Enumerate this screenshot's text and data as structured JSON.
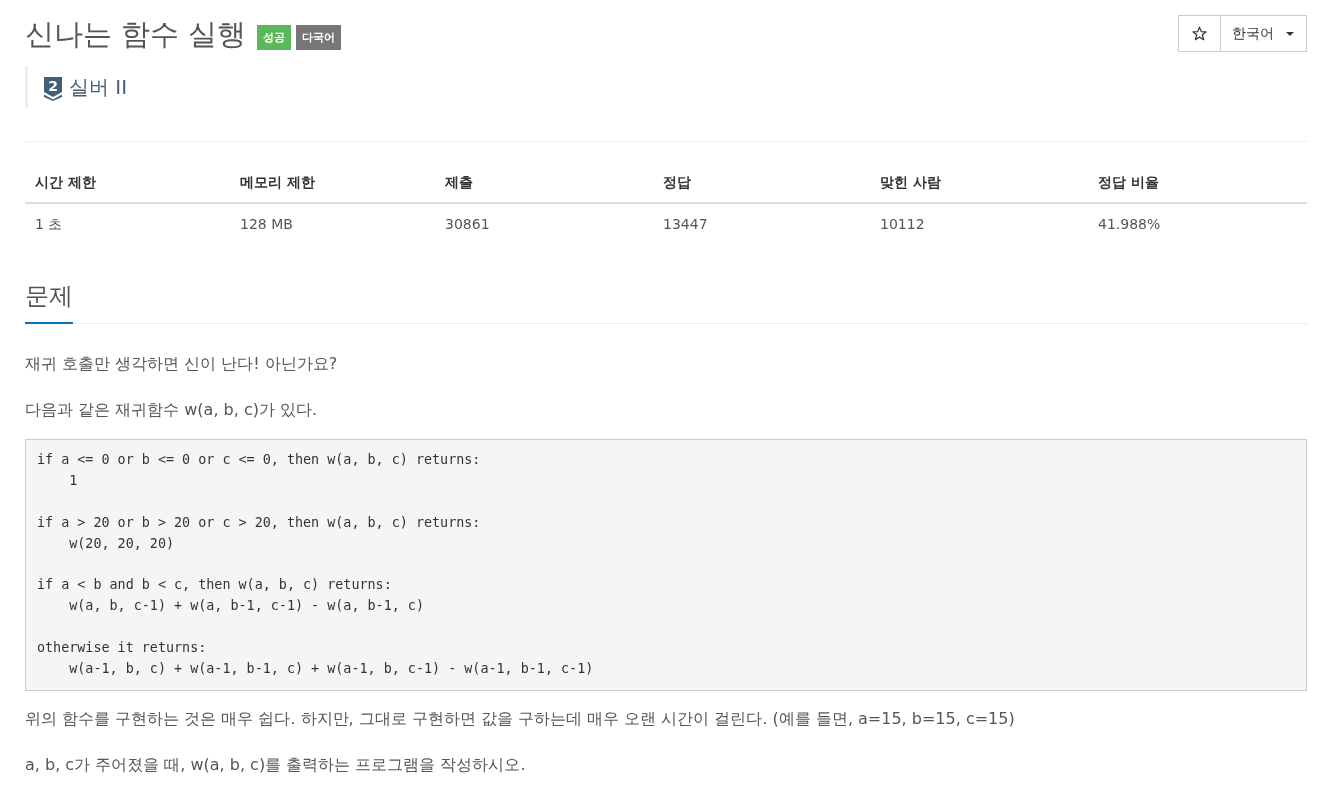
{
  "header": {
    "title": "신나는 함수 실행",
    "labels": [
      {
        "text": "성공",
        "color": "#5cb85c"
      },
      {
        "text": "다국어",
        "color": "#777777"
      }
    ]
  },
  "toolbar": {
    "starred": false,
    "language": "한국어"
  },
  "tier": {
    "number": "2",
    "name": "실버 II"
  },
  "table": {
    "columns": [
      "시간 제한",
      "메모리 제한",
      "제출",
      "정답",
      "맞힌 사람",
      "정답 비율"
    ],
    "rows": [
      [
        "1 초",
        "128 MB",
        "30861",
        "13447",
        "10112",
        "41.988%"
      ]
    ]
  },
  "section": {
    "title": "문제"
  },
  "statement": [
    {
      "kind": "text",
      "text": "재귀 호출만 생각하면 신이 난다! 아닌가요?"
    },
    {
      "kind": "text",
      "text": "다음과 같은 재귀함수 w(a, b, c)가 있다."
    },
    {
      "kind": "code",
      "text": "if a <= 0 or b <= 0 or c <= 0, then w(a, b, c) returns:\n    1\n\nif a > 20 or b > 20 or c > 20, then w(a, b, c) returns:\n    w(20, 20, 20)\n\nif a < b and b < c, then w(a, b, c) returns:\n    w(a, b, c-1) + w(a, b-1, c-1) - w(a, b-1, c)\n\notherwise it returns:\n    w(a-1, b, c) + w(a-1, b-1, c) + w(a-1, b, c-1) - w(a-1, b-1, c-1)"
    },
    {
      "kind": "text",
      "text": "위의 함수를 구현하는 것은 매우 쉽다. 하지만, 그대로 구현하면 값을 구하는데 매우 오랜 시간이 걸린다. (예를 들면, a=15, b=15, c=15)"
    },
    {
      "kind": "text",
      "text": "a, b, c가 주어졌을 때, w(a, b, c)를 출력하는 프로그램을 작성하시오."
    }
  ]
}
